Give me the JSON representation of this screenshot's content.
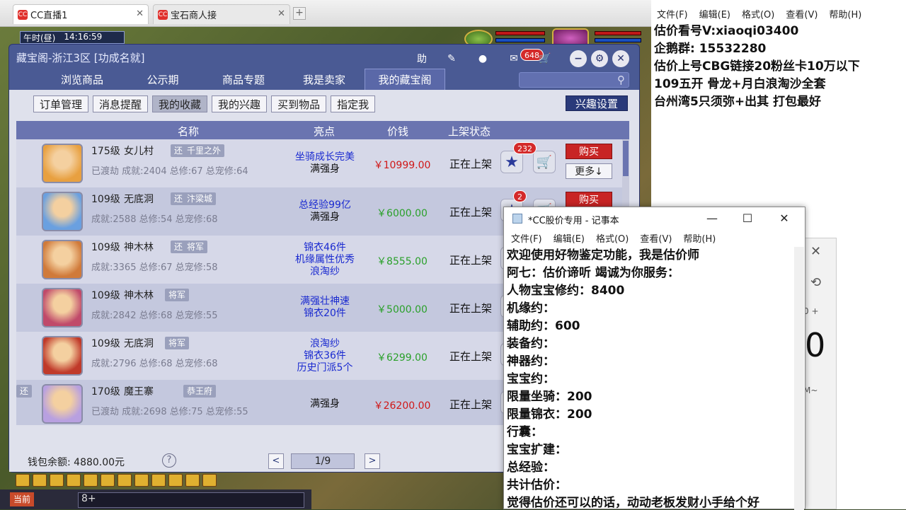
{
  "browser": {
    "tabs": [
      {
        "icon": "CC",
        "title": "CC直播1"
      },
      {
        "icon": "CC",
        "title": "宝石商人接"
      }
    ],
    "new_tab": "+",
    "close_glyph": "✕"
  },
  "game": {
    "time_label": "午时(昼)",
    "time": "14:16:59",
    "chat_prefix": "当前",
    "chat_text": "8+"
  },
  "cbg": {
    "title": "藏宝阁-浙江3区 [功成名就]",
    "help_btn": "助",
    "message_badge": "648",
    "nav_tabs": [
      "浏览商品",
      "公示期",
      "商品专题",
      "我是卖家",
      "我的藏宝阁"
    ],
    "active_nav": 4,
    "sub_tabs": [
      "订单管理",
      "消息提醒",
      "我的收藏",
      "我的兴趣",
      "买到物品",
      "指定我"
    ],
    "active_sub": 2,
    "interest_btn": "兴趣设置",
    "columns": {
      "name": "名称",
      "highlight": "亮点",
      "price": "价钱",
      "status": "上架状态"
    },
    "buy_label": "购买",
    "more_label": "更多↓",
    "rows": [
      {
        "level": "175级",
        "school": "女儿村",
        "tag1": "还",
        "tag2": "千里之外",
        "stats": "已渡劫 成就:2404 总修:67 总宠修:64",
        "hl_blue": [
          "坐骑成长完美"
        ],
        "hl_black": "满强身",
        "price": "￥10999.00",
        "price_color": "red",
        "status": "正在上架",
        "fav_count": "232"
      },
      {
        "level": "109级",
        "school": "无底洞",
        "tag1": "还",
        "tag2": "汴梁城",
        "stats": "成就:2588 总修:54 总宠修:68",
        "hl_blue": [
          "总经验99亿"
        ],
        "hl_black": "满强身",
        "price": "￥6000.00",
        "price_color": "green",
        "status": "正在上架",
        "fav_count": "2"
      },
      {
        "level": "109级",
        "school": "神木林",
        "tag1": "还",
        "tag2": "将军",
        "stats": "成就:3365 总修:67 总宠修:58",
        "hl_blue": [
          "锦衣46件",
          "机缘属性优秀",
          "浪淘纱"
        ],
        "hl_black": "",
        "price": "￥8555.00",
        "price_color": "green",
        "status": "正在上架",
        "fav_count": ""
      },
      {
        "level": "109级",
        "school": "神木林",
        "tag1": "",
        "tag2": "将军",
        "stats": "成就:2842 总修:68 总宠修:55",
        "hl_blue": [
          "满强壮神速",
          "锦衣20件"
        ],
        "hl_black": "",
        "price": "￥5000.00",
        "price_color": "green",
        "status": "正在上架",
        "fav_count": ""
      },
      {
        "level": "109级",
        "school": "无底洞",
        "tag1": "",
        "tag2": "将军",
        "stats": "成就:2796 总修:68 总宠修:68",
        "hl_blue": [
          "浪淘纱",
          "锦衣36件",
          "历史门派5个"
        ],
        "hl_black": "",
        "price": "￥6299.00",
        "price_color": "green",
        "status": "正在上架",
        "fav_count": ""
      },
      {
        "level": "170级",
        "school": "魔王寨",
        "tag1": "还",
        "tag2": "恭王府",
        "stats": "已渡劫 成就:2698 总修:75 总宠修:55",
        "hl_blue": [],
        "hl_black": "满强身",
        "price": "￥26200.00",
        "price_color": "red",
        "status": "正在上架",
        "fav_count": ""
      }
    ],
    "wallet": "钱包余额: 4880.00元",
    "help_glyph": "?",
    "page": "1/9",
    "prev": "<",
    "next": ">"
  },
  "notepad_top": {
    "menu": [
      "文件(F)",
      "编辑(E)",
      "格式(O)",
      "查看(V)",
      "帮助(H)"
    ],
    "lines": [
      "估价看号V:xiaoqi03400",
      "企鹅群: 15532280",
      "估价上号CBG链接20粉丝卡10万以下",
      "109五开 骨龙+月白浪淘沙全套",
      "台州湾5只须弥+出其 打包最好"
    ]
  },
  "calculator": {
    "c1": "✕",
    "c2": "⟲",
    "c3": "0 +",
    "c4": "0",
    "c5": "M~"
  },
  "notepad_front": {
    "title": "*CC股价专用 - 记事本",
    "menu": [
      "文件(F)",
      "编辑(E)",
      "格式(O)",
      "查看(V)",
      "帮助(H)"
    ],
    "lines": [
      "欢迎使用好物鉴定功能，我是估价师",
      "阿七：估价谛听 竭诚为你服务：",
      "人物宝宝修约：8400",
      "机缘约：",
      "辅助约：600",
      "装备约：",
      "神器约：",
      "宝宝约：",
      "限量坐骑：200",
      "限量锦衣：200",
      "行囊：",
      "宝宝扩建：",
      "总经验：",
      "共计估价：",
      "觉得估价还可以的话，动动老板发财小手给个好"
    ]
  }
}
